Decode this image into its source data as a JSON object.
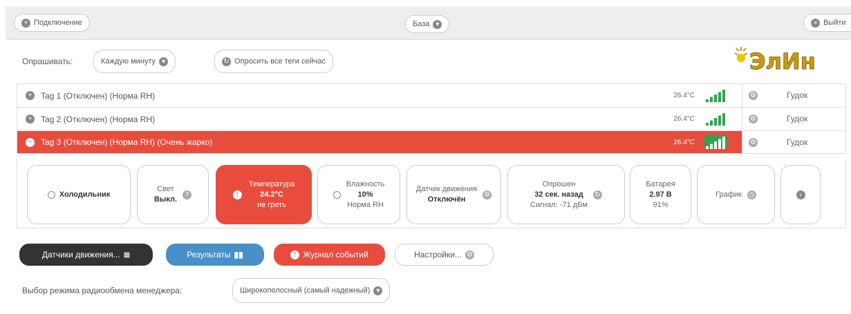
{
  "topbar": {
    "connect_label": "Подключение",
    "base_label": "База",
    "logout_label": "Выйти"
  },
  "poll": {
    "label": "Опрашивать:",
    "interval": "Каждую минуту",
    "poll_all_label": "Опросить все теги сейчас"
  },
  "logo_text": "ЭлИн",
  "tags": [
    {
      "name": "Tag 1 (Отключен) (Норма RH)",
      "temp": "26.4°C",
      "beep": "Гудок",
      "active": false
    },
    {
      "name": "Tag 2 (Отключен) (Норма RH)",
      "temp": "26.4°C",
      "beep": "Гудок",
      "active": false
    },
    {
      "name": "Tag 3 (Отключен) (Норма RH) (Очень жарко)",
      "temp": "26.4°C",
      "beep": "Гудок",
      "active": true
    }
  ],
  "detail": {
    "fridge": "Холодильник",
    "light_label": "Свет",
    "light_value": "Выкл.",
    "temp_label": "Температура",
    "temp_value": "24.2°C",
    "temp_state": "не греть",
    "humidity_label": "Влажность",
    "humidity_value": "10%",
    "humidity_state": "Норма RH",
    "motion_label": "Датчик движения",
    "motion_value": "Отключён",
    "polled_label": "Опрошен",
    "polled_value": "32 сек. назад",
    "signal_text": "Сигнал: -71 дБм",
    "battery_label": "Батарея",
    "battery_voltage": "2.97 В",
    "battery_percent": "91%",
    "chart_label": "График"
  },
  "buttons": {
    "motion_sensors": "Датчики движения...",
    "results": "Результаты",
    "event_log": "Журнал событий",
    "settings": "Настройки..."
  },
  "radio": {
    "label": "Выбор режима радиообмена менеджера:",
    "value": "Широкополосный (самый надежный)"
  },
  "colors": {
    "alarm": "#e84c3d",
    "dark": "#333333",
    "blue": "#4a90c8",
    "signal": "#2ea44f",
    "logo": "#c99a14"
  }
}
